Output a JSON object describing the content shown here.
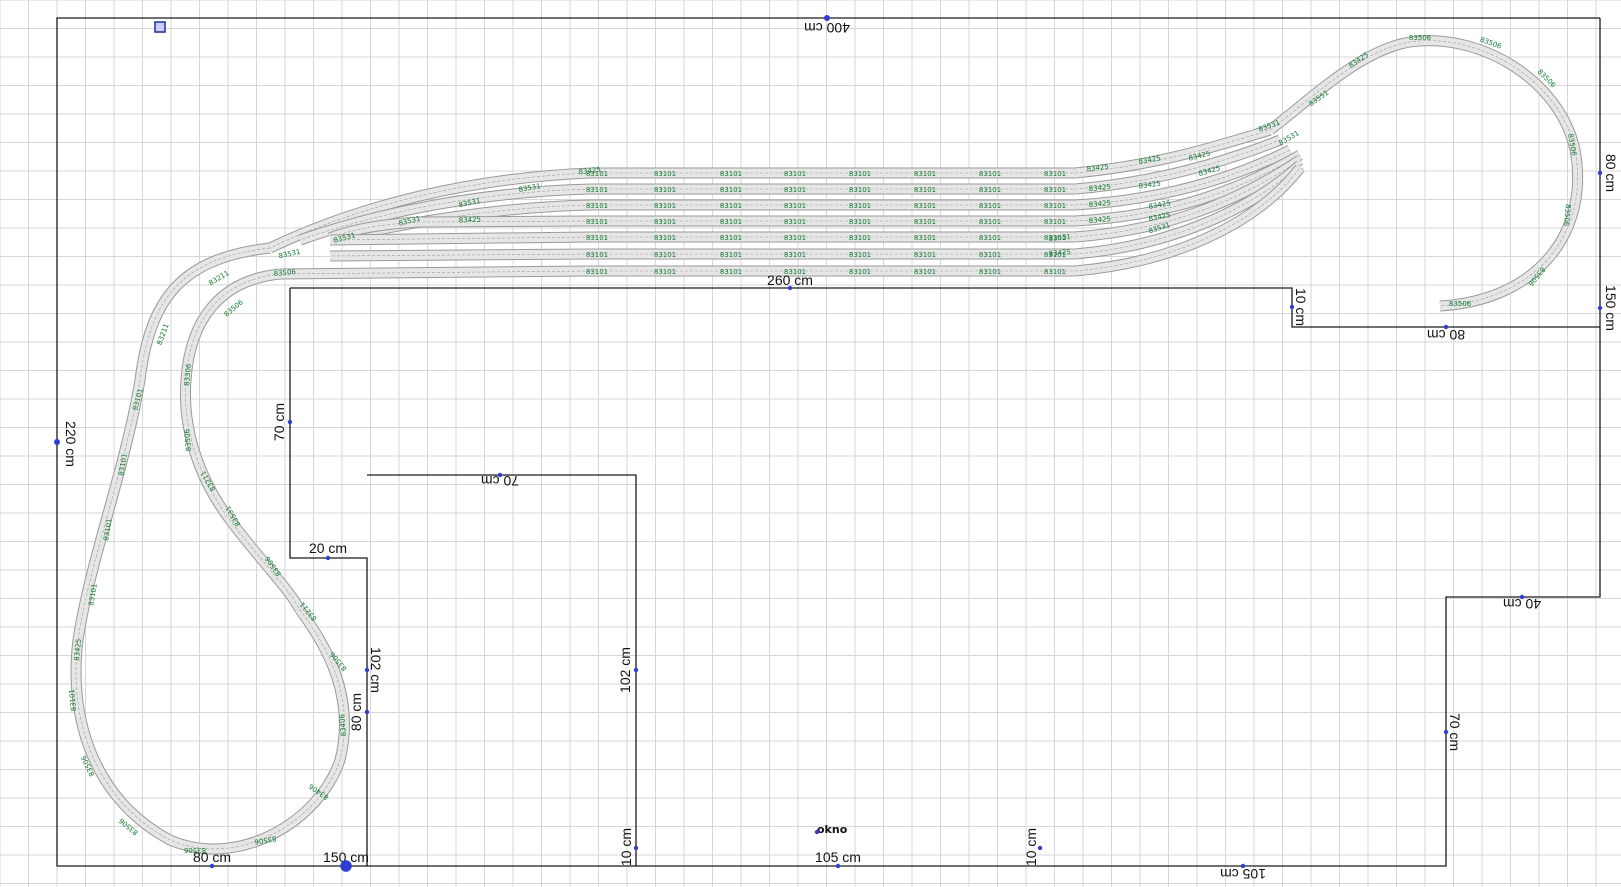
{
  "colors": {
    "background": "#ffffff",
    "grid": "#d7d7d7",
    "outline": "#1a1a1a",
    "track_fill": "#e6e6e6",
    "track_edge": "#9a9a9a",
    "part_label": "#0e7a2e",
    "node": "#2f3dd4"
  },
  "dimensions": {
    "top": "400 cm",
    "left": "220 cm",
    "inner_top": "260 cm",
    "inner_left": "70 cm",
    "notch_top": "70 cm",
    "notch_step": "20 cm",
    "notch_left": "102 cm",
    "notch_right": "102 cm",
    "loop_side": "80 cm",
    "right_upper": "80 cm",
    "right_mid": "150 cm",
    "right_step": "10 cm",
    "right_shelf": "80 cm",
    "lower_step": "40 cm",
    "lower_right": "70 cm",
    "bottom_left": "80 cm",
    "bottom_mid_left": "150 cm",
    "bottom_mid": "105 cm",
    "bottom_right": "105 cm",
    "tick_a": "10 cm",
    "tick_b": "10 cm"
  },
  "window_label": "okno",
  "track_parts": {
    "straight": "83101",
    "yard_row": [
      "83425",
      "83101",
      "83101",
      "83101",
      "83101",
      "83101",
      "83101",
      "83101",
      "83101",
      "83425"
    ],
    "curve_a": "83506",
    "curve_b": "83406",
    "curve_c": "83306",
    "switch": "83531",
    "switch_b": "83551",
    "flex": "83211"
  }
}
